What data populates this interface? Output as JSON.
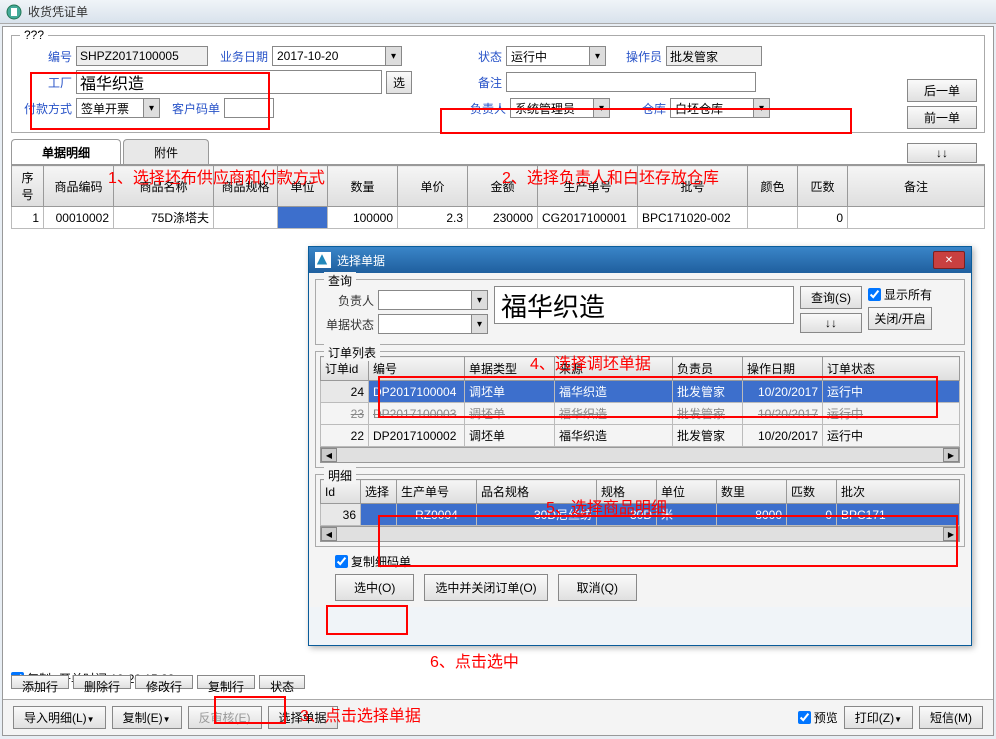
{
  "window": {
    "title": "收货凭证单"
  },
  "form": {
    "section_legend": "???",
    "serial_label": "编号",
    "serial": "SHPZ2017100005",
    "bizdate_label": "业务日期",
    "bizdate": "2017-10-20",
    "status_label": "状态",
    "status": "运行中",
    "operator_label": "操作员",
    "operator": "批发管家",
    "factory_label": "工厂",
    "factory": "福华织造",
    "pick_btn": "选",
    "remark_label": "备注",
    "remark": "",
    "paymethod_label": "付款方式",
    "paymethod": "签单开票",
    "customercode_label": "客户码单",
    "responsible_label": "负责人",
    "responsible": "系统管理员",
    "warehouse_label": "仓库",
    "warehouse": "白坯仓库",
    "next_btn": "后一单",
    "prev_btn": "前一单",
    "arrows_btn": "↓↓"
  },
  "tabs": {
    "detail": "单据明细",
    "attach": "附件"
  },
  "grid_headers": {
    "seq": "序号",
    "code": "商品编码",
    "name": "商品名称",
    "spec": "商品规格",
    "unit": "单位",
    "qty": "数量",
    "price": "单价",
    "amount": "金额",
    "prodno": "生产单号",
    "batch": "批号",
    "color": "颜色",
    "pi": "匹数",
    "remark": "备注"
  },
  "grid_rows": [
    {
      "seq": "1",
      "code": "00010002",
      "name": "75D涤塔夫",
      "spec": "",
      "unit": "",
      "qty": "100000",
      "price": "2.3",
      "amount": "230000",
      "prodno": "CG2017100001",
      "batch": "BPC171020-002",
      "color": "",
      "pi": "0",
      "remark": ""
    }
  ],
  "annotations": {
    "a1": "1、选择坯布供应商和付款方式",
    "a2": "2、选择负责人和白坯存放仓库",
    "a3": "3、点击选择单据",
    "a4": "4、选择调坯单据",
    "a5": "5、选择商品明细",
    "a6": "6、点击选中"
  },
  "dialog": {
    "title": "选择单据",
    "query_legend": "查询",
    "responsible_label": "负责人",
    "docstatus_label": "单据状态",
    "search_value": "福华织造",
    "query_btn": "查询(S)",
    "show_all": "显示所有",
    "close_toggle": "关闭/开启",
    "orderlist_legend": "订单列表",
    "order_headers": {
      "id": "订单id",
      "no": "编号",
      "type": "单据类型",
      "source": "来源",
      "resp": "负责员",
      "opdate": "操作日期",
      "status": "订单状态"
    },
    "order_rows": [
      {
        "id": "24",
        "no": "DP2017100004",
        "type": "调坯单",
        "source": "福华织造",
        "resp": "批发管家",
        "opdate": "10/20/2017",
        "status": "运行中",
        "sel": true
      },
      {
        "id": "23",
        "no": "DP2017100003",
        "type": "调坯单",
        "source": "福华织造",
        "resp": "批发管家",
        "opdate": "10/20/2017",
        "status": "运行中",
        "strike": true
      },
      {
        "id": "22",
        "no": "DP2017100002",
        "type": "调坯单",
        "source": "福华织造",
        "resp": "批发管家",
        "opdate": "10/20/2017",
        "status": "运行中"
      }
    ],
    "detail_legend": "明细",
    "detail_headers": {
      "id": "Id",
      "sel": "选择",
      "prodno": "生产单号",
      "namespec": "品名规格",
      "spec": "规格",
      "unit": "单位",
      "qty": "数里",
      "pi": "匹数",
      "batch": "批次"
    },
    "detail_rows": [
      {
        "id": "36",
        "sel": "",
        "prodno": "RZ0004",
        "namespec": "30D尼丝纺",
        "spec": "30D",
        "unit": "米",
        "qty": "8000",
        "pi": "0",
        "batch": "BPC171",
        "selRow": true
      }
    ],
    "copy_detail": "复制细码单",
    "select_btn": "选中(O)",
    "select_close_btn": "选中并关闭订单(O)",
    "cancel_btn": "取消(Q)"
  },
  "footer": {
    "copy_check": "复制",
    "opentime_label": "开单时间:",
    "opentime": "10·20 15:38",
    "addrow": "添加行",
    "delrow": "删除行",
    "editrow": "修改行",
    "copyrow": "复制行",
    "status": "状态",
    "import": "导入明细(L)",
    "copy2": "复制(E)",
    "review": "反审核(E)",
    "selectdoc": "选择单据",
    "preview": "预览",
    "print": "打印(Z)",
    "sms": "短信(M)"
  }
}
